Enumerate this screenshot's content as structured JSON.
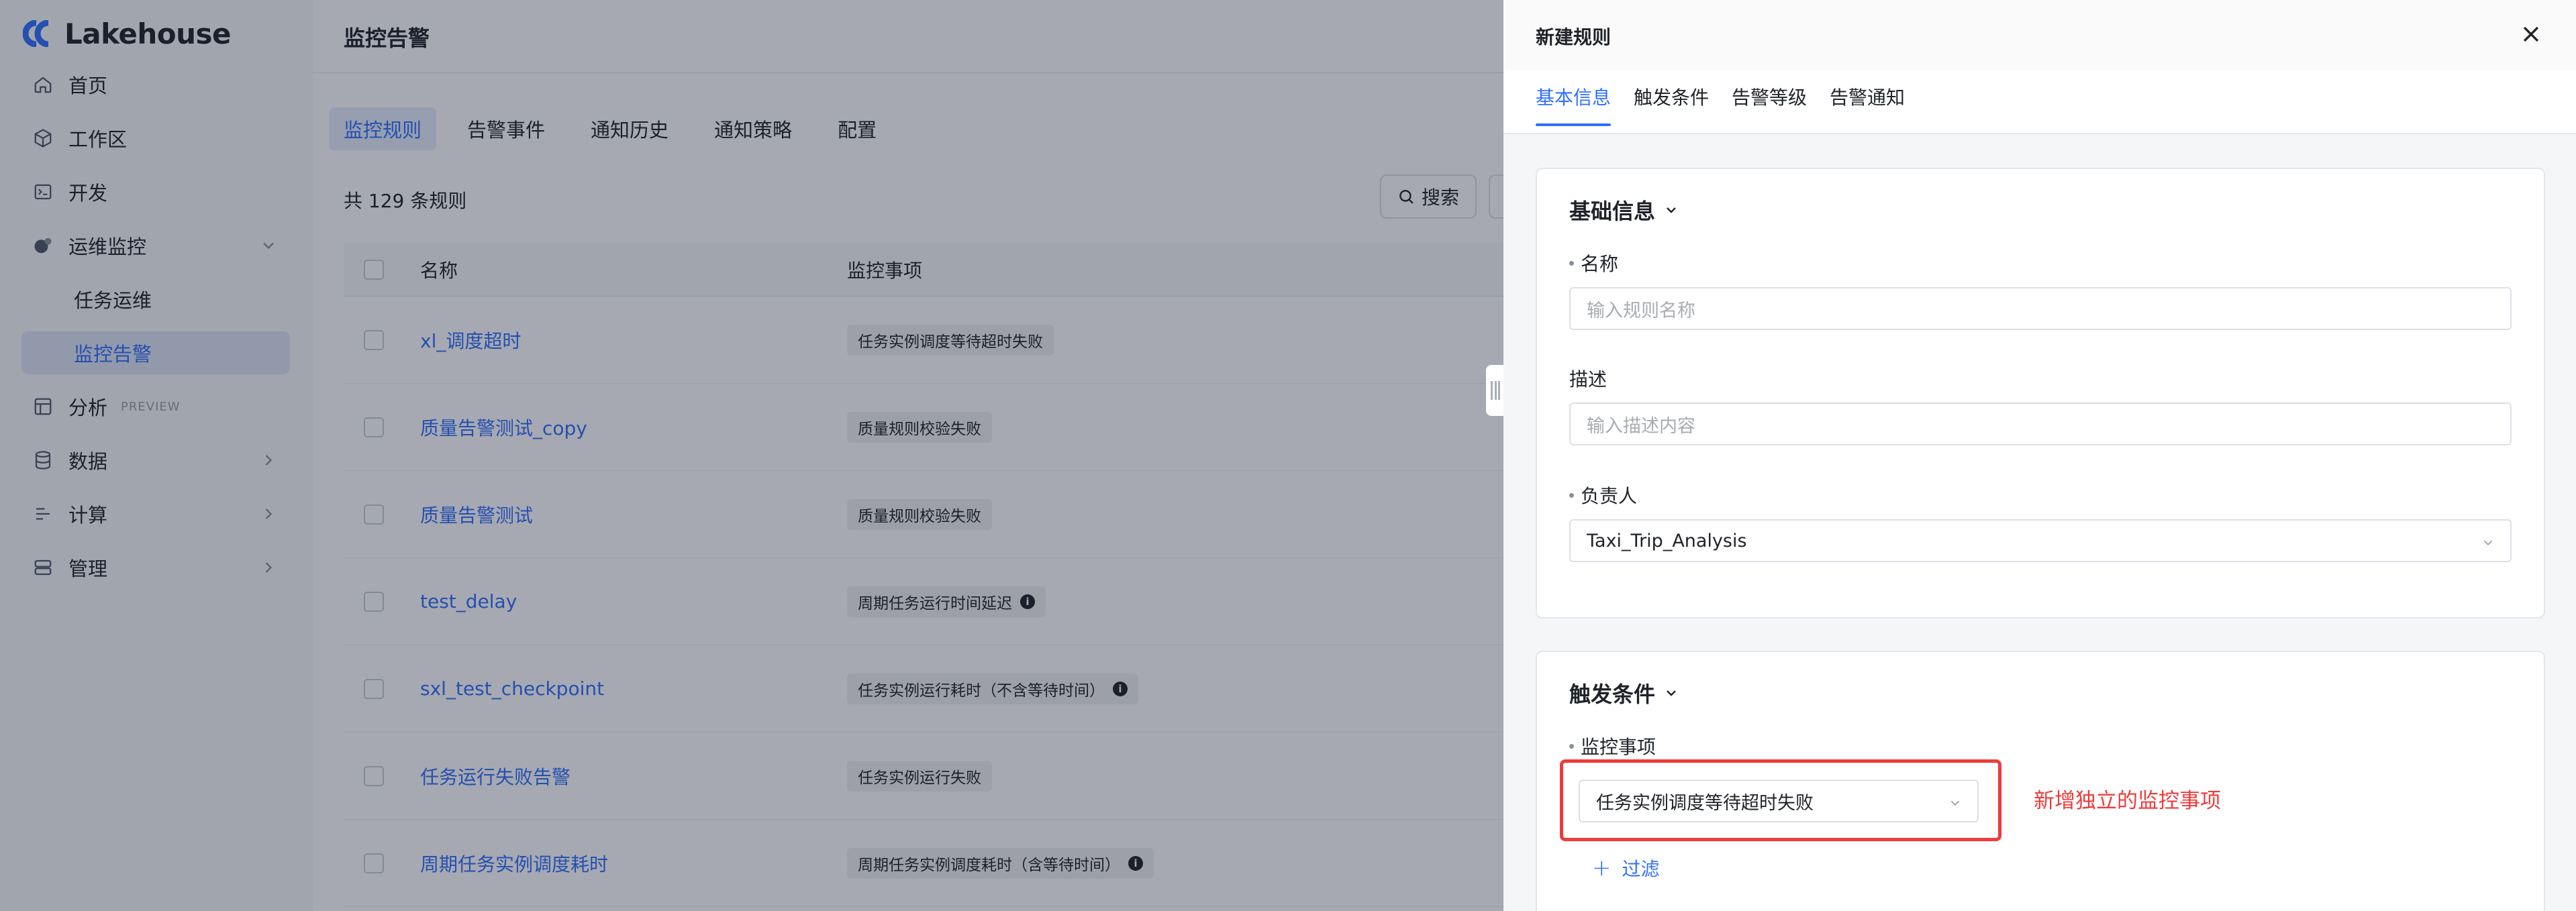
{
  "app": {
    "logo_text": "Lakehouse"
  },
  "sidebar": {
    "items": [
      {
        "label": "首页",
        "icon": "home-icon"
      },
      {
        "label": "工作区",
        "icon": "cube-icon"
      },
      {
        "label": "开发",
        "icon": "terminal-icon"
      },
      {
        "label": "运维监控",
        "icon": "monitor-icon"
      },
      {
        "label": "任务运维"
      },
      {
        "label": "监控告警"
      },
      {
        "label": "分析",
        "icon": "analysis-icon",
        "tag": "PREVIEW"
      },
      {
        "label": "数据",
        "icon": "database-icon"
      },
      {
        "label": "计算",
        "icon": "compute-icon"
      },
      {
        "label": "管理",
        "icon": "manage-icon"
      }
    ]
  },
  "main": {
    "title": "监控告警",
    "tabs": [
      "监控规则",
      "告警事件",
      "通知历史",
      "通知策略",
      "配置"
    ],
    "rule_count": "共 129 条规则",
    "search_label": "搜索",
    "columns": {
      "name": "名称",
      "item": "监控事项"
    },
    "rows": [
      {
        "name": "xl_调度超时",
        "item": "任务实例调度等待超时失败",
        "info": false
      },
      {
        "name": "质量告警测试_copy",
        "item": "质量规则校验失败",
        "info": false
      },
      {
        "name": "质量告警测试",
        "item": "质量规则校验失败",
        "info": false
      },
      {
        "name": "test_delay",
        "item": "周期任务运行时间延迟",
        "info": true
      },
      {
        "name": "sxl_test_checkpoint",
        "item": "任务实例运行耗时（不含等待时间）",
        "info": true
      },
      {
        "name": "任务运行失败告警",
        "item": "任务实例运行失败",
        "info": false
      },
      {
        "name": "周期任务实例调度耗时",
        "item": "周期任务实例调度耗时（含等待时间）",
        "info": true
      }
    ]
  },
  "drawer": {
    "title": "新建规则",
    "tabs": [
      "基本信息",
      "触发条件",
      "告警等级",
      "告警通知"
    ],
    "basic": {
      "section_title": "基础信息",
      "name_label": "名称",
      "name_placeholder": "输入规则名称",
      "desc_label": "描述",
      "desc_placeholder": "输入描述内容",
      "owner_label": "负责人",
      "owner_value": "Taxi_Trip_Analysis"
    },
    "trigger": {
      "section_title": "触发条件",
      "item_label": "监控事项",
      "item_value": "任务实例调度等待超时失败",
      "filter_label": "过滤"
    },
    "annotation": "新增独立的监控事项"
  },
  "colors": {
    "accent": "#2f6fff",
    "annotation_red": "#ee3b3b"
  }
}
